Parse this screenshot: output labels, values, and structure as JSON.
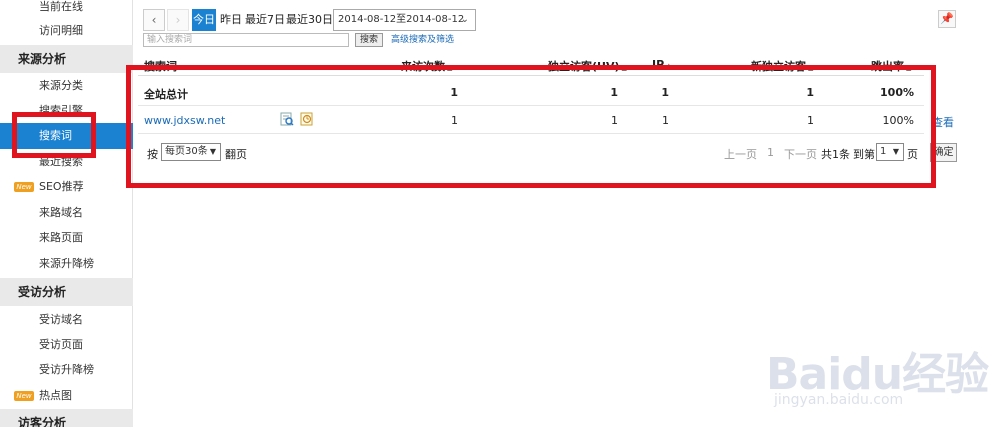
{
  "sidebar": {
    "items": [
      {
        "label": "当前在线"
      },
      {
        "label": "访问明细"
      },
      {
        "label": "来源分析",
        "section": true
      },
      {
        "label": "来源分类"
      },
      {
        "label": "搜索引擎"
      },
      {
        "label": "搜索词",
        "active": true
      },
      {
        "label": "最近搜索"
      },
      {
        "label": "SEO推荐",
        "badge": "New"
      },
      {
        "label": "来路域名"
      },
      {
        "label": "来路页面"
      },
      {
        "label": "来源升降榜"
      },
      {
        "label": "受访分析",
        "section": true
      },
      {
        "label": "受访域名"
      },
      {
        "label": "受访页面"
      },
      {
        "label": "受访升降榜"
      },
      {
        "label": "热点图",
        "badge": "New"
      },
      {
        "label": "访客分析",
        "section": true
      }
    ]
  },
  "toolbar": {
    "prev_icon": "chevron-left-icon",
    "next_icon": "chevron-right-icon",
    "today": "今日",
    "yesterday": "昨日",
    "last7": "最近7日",
    "last30": "最近30日",
    "date_range": "2014-08-12至2014-08-12",
    "pin_icon": "pin-icon"
  },
  "search": {
    "placeholder": "输入搜索词",
    "button": "搜索",
    "advanced": "高级搜索及筛选"
  },
  "table": {
    "headers": [
      "搜索词",
      "来访次数",
      "独立访客(UV)",
      "IP",
      "新独立访客",
      "跳出率"
    ],
    "total": {
      "label": "全站总计",
      "visits": "1",
      "uv": "1",
      "ip": "1",
      "new_uv": "1",
      "bounce": "100%"
    },
    "rows": [
      {
        "keyword": "www.jdxsw.net",
        "visits": "1",
        "uv": "1",
        "ip": "1",
        "new_uv": "1",
        "bounce": "100%",
        "action": "查看"
      }
    ]
  },
  "pager": {
    "prefix": "按",
    "per_page": "每页30条",
    "suffix": "翻页",
    "prev": "上一页",
    "current": "1",
    "next": "下一页",
    "total": "共1条",
    "goto": "到第",
    "page_value": "1",
    "page_unit": "页",
    "confirm": "确定"
  },
  "watermark": {
    "brand": "Baidu经验",
    "url": "jingyan.baidu.com"
  },
  "colors": {
    "accent": "#1b82d2",
    "annotation_red": "#e0141e",
    "link": "#1b6bb8"
  }
}
